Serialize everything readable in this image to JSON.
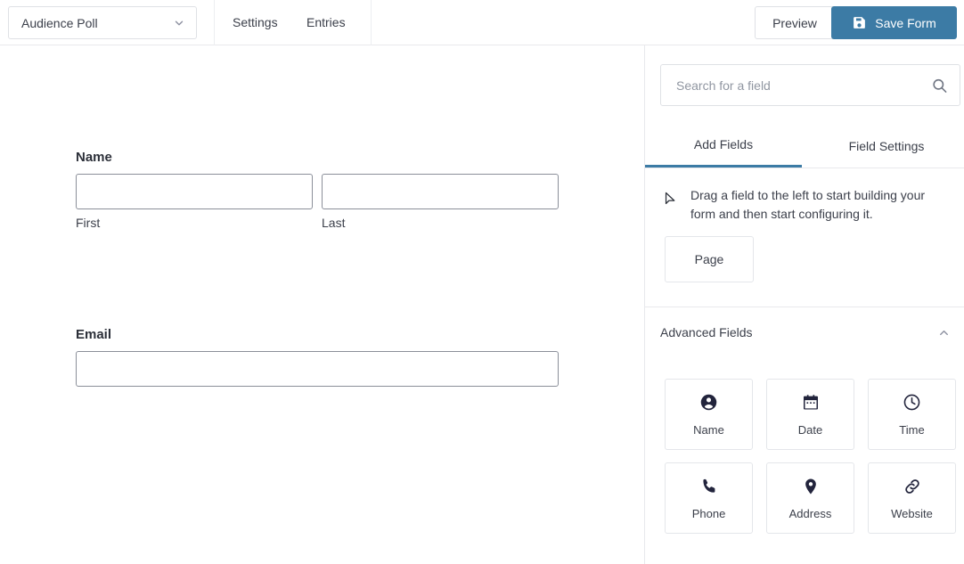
{
  "topbar": {
    "form_selector": {
      "value": "Audience Poll",
      "icon": "chevron-down-icon"
    },
    "nav": [
      {
        "label": "Settings"
      },
      {
        "label": "Entries"
      }
    ],
    "preview_label": "Preview",
    "save_label": "Save Form",
    "save_icon": "save-floppy-icon",
    "accent_color": "#3c7ba5"
  },
  "canvas": {
    "fields": [
      {
        "label": "Name",
        "type": "name",
        "inputs": [
          {
            "sublabel": "First",
            "value": ""
          },
          {
            "sublabel": "Last",
            "value": ""
          }
        ]
      },
      {
        "label": "Email",
        "type": "email",
        "inputs": [
          {
            "sublabel": "",
            "value": ""
          }
        ]
      }
    ]
  },
  "panel": {
    "search": {
      "placeholder": "Search for a field",
      "value": "",
      "icon": "search-icon"
    },
    "tabs": [
      {
        "label": "Add Fields",
        "active": true
      },
      {
        "label": "Field Settings",
        "active": false
      }
    ],
    "hint": {
      "icon": "cursor-arrow-icon",
      "text": "Drag a field to the left to start building your form and then start configuring it."
    },
    "page_card": {
      "label": "Page"
    },
    "section": {
      "title": "Advanced Fields",
      "collapse_icon": "chevron-up-icon",
      "expanded": true
    },
    "field_cards": [
      {
        "label": "Name",
        "icon": "person-circle-icon"
      },
      {
        "label": "Date",
        "icon": "calendar-icon"
      },
      {
        "label": "Time",
        "icon": "clock-icon"
      },
      {
        "label": "Phone",
        "icon": "phone-icon"
      },
      {
        "label": "Address",
        "icon": "map-pin-icon"
      },
      {
        "label": "Website",
        "icon": "link-icon"
      }
    ]
  }
}
